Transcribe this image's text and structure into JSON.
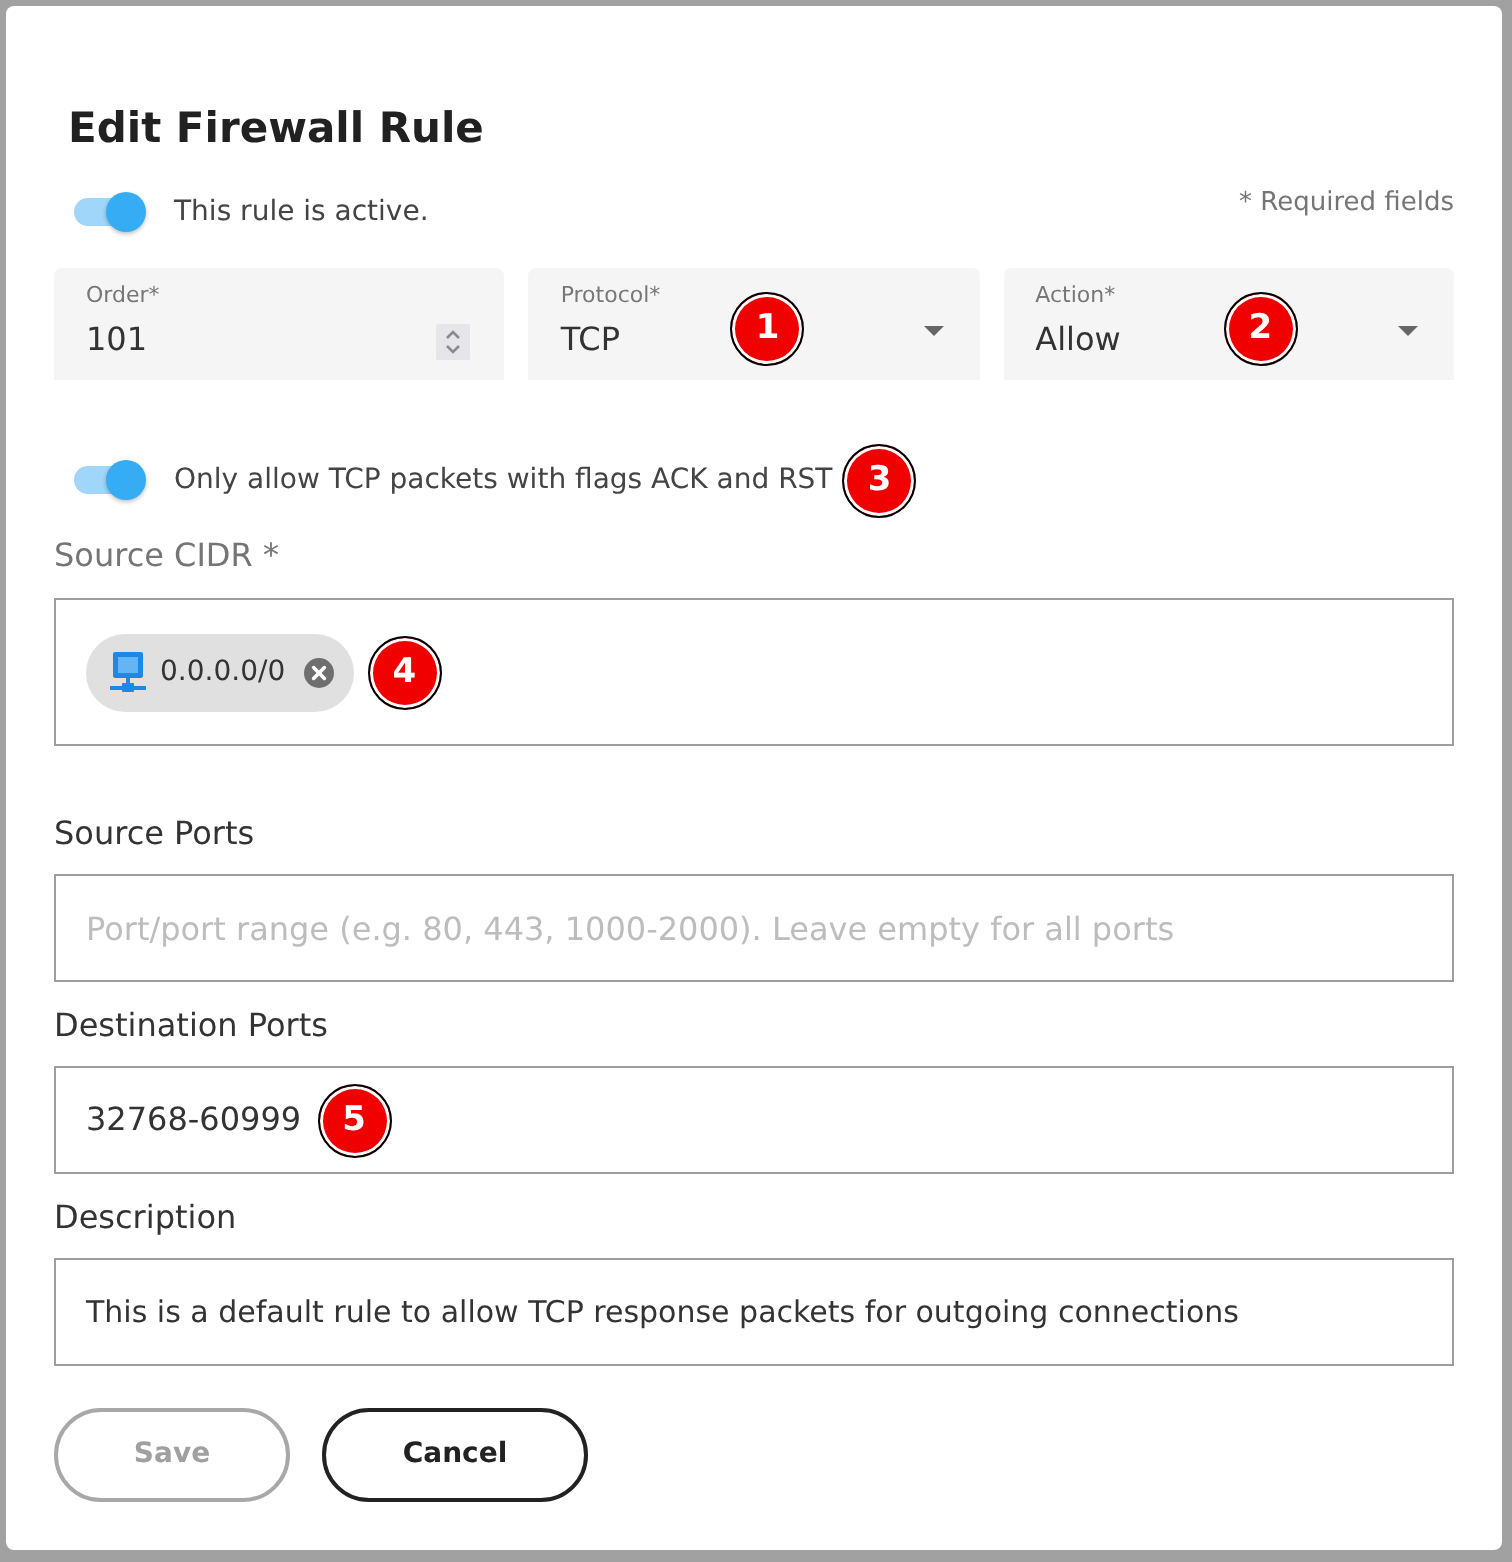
{
  "dialog": {
    "title": "Edit Firewall Rule"
  },
  "active_toggle": {
    "label": "This rule is active.",
    "on": true
  },
  "required_note": "* Required fields",
  "fields": [
    {
      "kind": "number",
      "label": "Order*",
      "value": "101"
    },
    {
      "kind": "select",
      "label": "Protocol*",
      "value": "TCP",
      "marker": "1"
    },
    {
      "kind": "select",
      "label": "Action*",
      "value": "Allow",
      "marker": "2"
    }
  ],
  "flags_toggle": {
    "label": "Only allow TCP packets with flags ACK and RST",
    "on": true,
    "marker": "3"
  },
  "source_cidr": {
    "label": "Source CIDR *",
    "chips": [
      {
        "value": "0.0.0.0/0"
      }
    ],
    "marker": "4"
  },
  "source_ports": {
    "label": "Source Ports",
    "placeholder": "Port/port range (e.g. 80, 443, 1000-2000). Leave empty for all ports"
  },
  "destination_ports": {
    "label": "Destination Ports",
    "value": "32768-60999",
    "marker": "5"
  },
  "description": {
    "label": "Description",
    "value": "This is a default rule to allow TCP response packets for outgoing connections"
  },
  "buttons": [
    {
      "label": "Save",
      "disabled": true
    },
    {
      "label": "Cancel",
      "disabled": false
    }
  ]
}
